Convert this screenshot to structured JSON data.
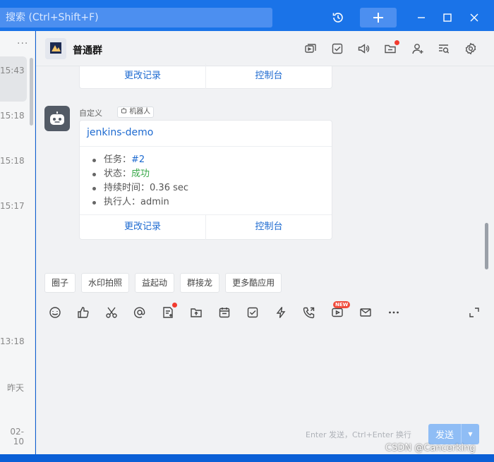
{
  "titlebar": {
    "search_placeholder": "搜索 (Ctrl+Shift+F)",
    "icons": [
      "history-icon",
      "plus-icon",
      "minimize-icon",
      "maximize-icon",
      "close-icon"
    ]
  },
  "sidebar": {
    "more": "···",
    "times": [
      "15:43",
      "15:18",
      "15:18",
      "15:17",
      "13:18",
      "昨天",
      "02-10"
    ]
  },
  "chat": {
    "group_name": "普通群",
    "header_icons": [
      "screen-share-icon",
      "todo-icon",
      "announcement-icon",
      "folder-icon",
      "add-member-icon",
      "search-history-icon",
      "settings-icon"
    ]
  },
  "prev_card": {
    "action1": "更改记录",
    "action2": "控制台"
  },
  "message": {
    "sender": "自定义",
    "badge": "机器人",
    "title": "jenkins-demo",
    "items": [
      {
        "label": "任务：",
        "value": "#2"
      },
      {
        "label": "状态：",
        "value": "成功"
      },
      {
        "label": "持续时间：",
        "value": "0.36 sec"
      },
      {
        "label": "执行人：",
        "value": "admin"
      }
    ],
    "action1": "更改记录",
    "action2": "控制台"
  },
  "apps": [
    "圈子",
    "水印拍照",
    "益起动",
    "群接龙",
    "更多酷应用"
  ],
  "toolbar": {
    "new_badge": "NEW",
    "icons": [
      "emoji-icon",
      "like-icon",
      "scissors-icon",
      "mention-icon",
      "document-icon",
      "upload-icon",
      "calendar-icon",
      "check-task-icon",
      "flash-icon",
      "phone-icon",
      "video-icon",
      "mail-icon",
      "more-icon",
      "expand-icon"
    ]
  },
  "composer": {
    "hint": "Enter 发送，Ctrl+Enter 换行",
    "send": "发送"
  },
  "watermark": "CSDN @Cancerking"
}
